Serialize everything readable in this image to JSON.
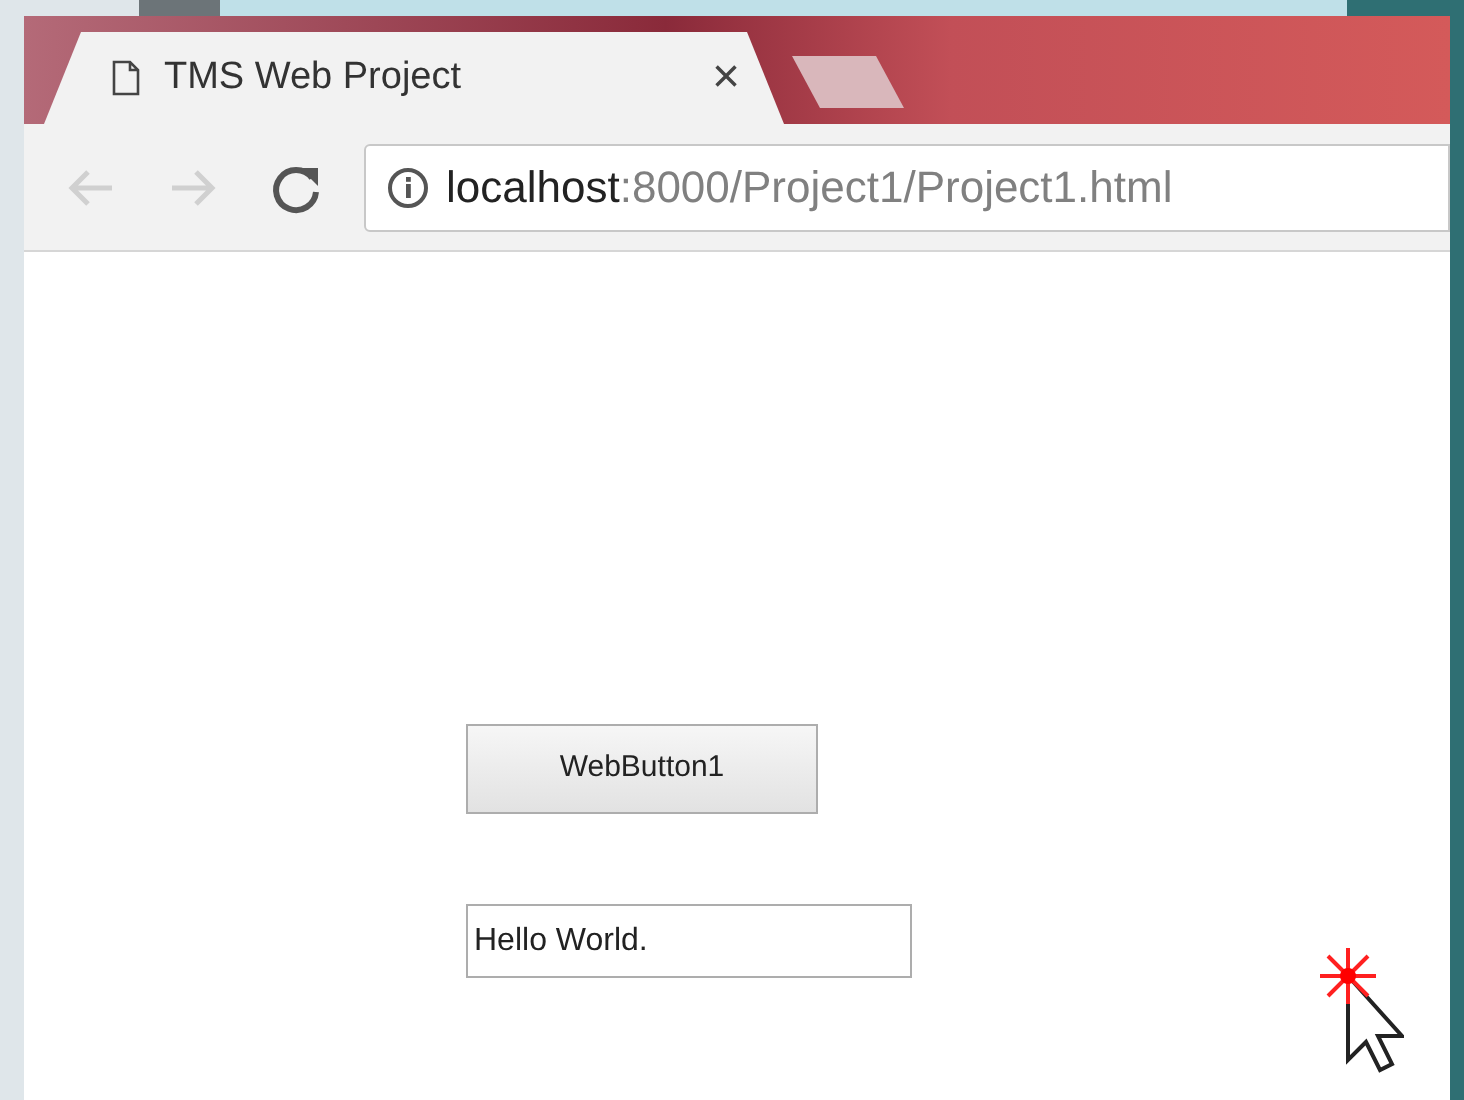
{
  "tabs": [
    {
      "title": "TMS Web Project",
      "close": "×",
      "selected": true
    }
  ],
  "toolbar": {
    "back": {
      "disabled": true
    },
    "forward": {
      "disabled": true
    }
  },
  "address_bar": {
    "host": "localhost",
    "path": ":8000/Project1/Project1.html"
  },
  "page": {
    "button": "WebButton1",
    "text_field": {
      "value": "Hello World."
    }
  }
}
